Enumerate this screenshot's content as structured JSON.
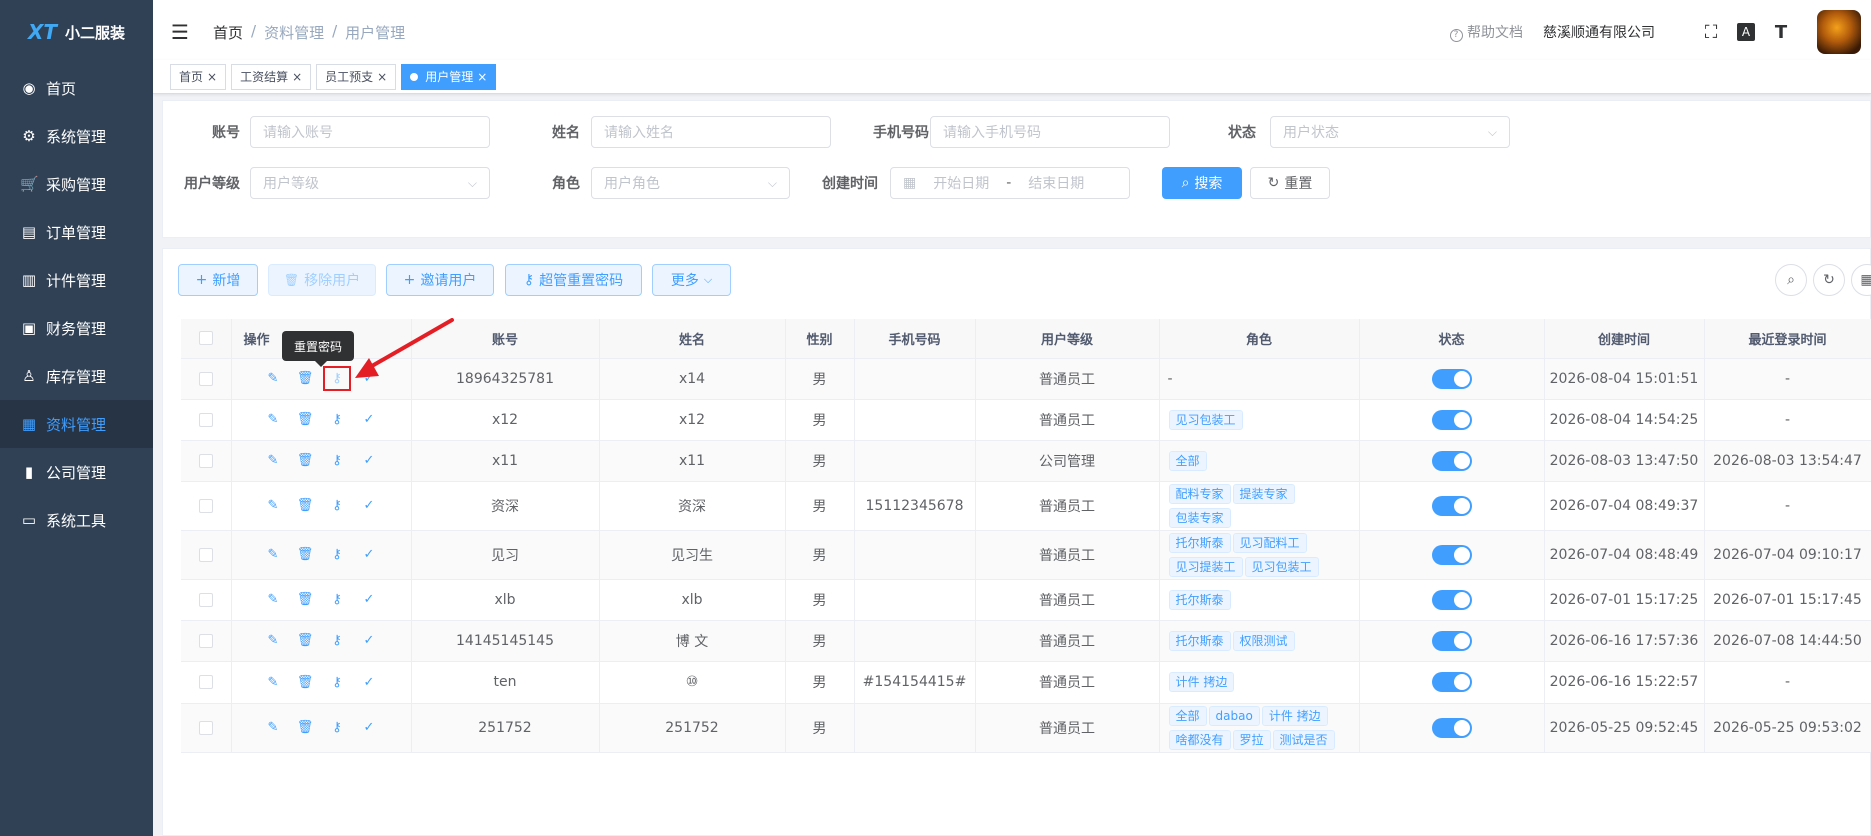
{
  "app": {
    "name": "小二服装",
    "logo_text": "XT"
  },
  "sidebar": {
    "items": [
      {
        "label": "首页",
        "icon": "dashboard-icon",
        "glyph": "◉"
      },
      {
        "label": "系统管理",
        "icon": "gear-icon",
        "glyph": "⚙"
      },
      {
        "label": "采购管理",
        "icon": "cart-icon",
        "glyph": "🛒"
      },
      {
        "label": "订单管理",
        "icon": "order-icon",
        "glyph": "▤"
      },
      {
        "label": "计件管理",
        "icon": "book-icon",
        "glyph": "▥"
      },
      {
        "label": "财务管理",
        "icon": "monitor-icon",
        "glyph": "▣"
      },
      {
        "label": "库存管理",
        "icon": "user-icon",
        "glyph": "♙"
      },
      {
        "label": "资料管理",
        "icon": "document-icon",
        "glyph": "▦"
      },
      {
        "label": "公司管理",
        "icon": "chart-icon",
        "glyph": "▮"
      },
      {
        "label": "系统工具",
        "icon": "toolbox-icon",
        "glyph": "▭"
      }
    ],
    "active_index": 7
  },
  "navbar": {
    "breadcrumb": [
      "首页",
      "资料管理",
      "用户管理"
    ],
    "separator": "/",
    "help": "帮助文档",
    "help_icon": "?",
    "company": "慈溪顺通有限公司",
    "fullscreen_icon": "⛶",
    "translate_icon": "A",
    "font_size_icon": "T"
  },
  "tags": [
    {
      "label": "首页",
      "active": false
    },
    {
      "label": "工资结算",
      "active": false
    },
    {
      "label": "员工预支",
      "active": false
    },
    {
      "label": "用户管理",
      "active": true
    }
  ],
  "tag_close": "×",
  "filters": {
    "account_label": "账号",
    "account_placeholder": "请输入账号",
    "name_label": "姓名",
    "name_placeholder": "请输入姓名",
    "phone_label": "手机号码",
    "phone_placeholder": "请输入手机号码",
    "status_label": "状态",
    "status_placeholder": "用户状态",
    "level_label": "用户等级",
    "level_placeholder": "用户等级",
    "role_label": "角色",
    "role_placeholder": "用户角色",
    "created_label": "创建时间",
    "start_placeholder": "开始日期",
    "date_sep": "-",
    "end_placeholder": "结束日期",
    "search_button": "搜索",
    "reset_button": "重置",
    "dropdown_glyph": "⌵",
    "calendar_glyph": "▦",
    "search_glyph": "⌕",
    "reset_glyph": "↻"
  },
  "toolbar": {
    "add": "新增",
    "remove": "移除用户",
    "invite": "邀请用户",
    "reset_pwd": "超管重置密码",
    "more": "更多",
    "plus_glyph": "+",
    "trash_glyph": "🗑",
    "key_glyph": "⚷",
    "chevron_glyph": "⌵",
    "search_glyph": "⌕",
    "refresh_glyph": "↻",
    "grid_glyph": "▦"
  },
  "table": {
    "headers": [
      "操作",
      "账号",
      "姓名",
      "性别",
      "手机号码",
      "用户等级",
      "角色",
      "状态",
      "创建时间",
      "最近登录时间"
    ],
    "op_glyphs": {
      "edit": "✎",
      "delete": "🗑",
      "key": "⚷",
      "check": "✓"
    },
    "rows": [
      {
        "account": "18964325781",
        "name": "x14",
        "gender": "男",
        "phone": "",
        "level": "普通员工",
        "roles": [],
        "roles_text": "-",
        "created": "2026-08-04 15:01:51",
        "last_login": "-"
      },
      {
        "account": "x12",
        "name": "x12",
        "gender": "男",
        "phone": "",
        "level": "普通员工",
        "roles": [
          "见习包装工"
        ],
        "roles_text": "",
        "created": "2026-08-04 14:54:25",
        "last_login": "-"
      },
      {
        "account": "x11",
        "name": "x11",
        "gender": "男",
        "phone": "",
        "level": "公司管理",
        "roles": [
          "全部"
        ],
        "roles_text": "",
        "created": "2026-08-03 13:47:50",
        "last_login": "2026-08-03 13:54:47"
      },
      {
        "account": "资深",
        "name": "资深",
        "gender": "男",
        "phone": "15112345678",
        "level": "普通员工",
        "roles": [
          "配料专家",
          "提装专家",
          "包装专家"
        ],
        "roles_text": "",
        "created": "2026-07-04 08:49:37",
        "last_login": "-"
      },
      {
        "account": "见习",
        "name": "见习生",
        "gender": "男",
        "phone": "",
        "level": "普通员工",
        "roles": [
          "托尔斯泰",
          "见习配料工",
          "见习提装工",
          "见习包装工"
        ],
        "roles_text": "",
        "created": "2026-07-04 08:48:49",
        "last_login": "2026-07-04 09:10:17"
      },
      {
        "account": "xlb",
        "name": "xlb",
        "gender": "男",
        "phone": "",
        "level": "普通员工",
        "roles": [
          "托尔斯泰"
        ],
        "roles_text": "",
        "created": "2026-07-01 15:17:25",
        "last_login": "2026-07-01 15:17:45"
      },
      {
        "account": "14145145145",
        "name": "博 文",
        "gender": "男",
        "phone": "",
        "level": "普通员工",
        "roles": [
          "托尔斯泰",
          "权限测试"
        ],
        "roles_text": "",
        "created": "2026-06-16 17:57:36",
        "last_login": "2026-07-08 14:44:50"
      },
      {
        "account": "ten",
        "name": "⑩",
        "gender": "男",
        "phone": "#154154415#",
        "level": "普通员工",
        "roles": [
          "计件 拷边"
        ],
        "roles_text": "",
        "created": "2026-06-16 15:22:57",
        "last_login": "-"
      },
      {
        "account": "251752",
        "name": "251752",
        "gender": "男",
        "phone": "",
        "level": "普通员工",
        "roles": [
          "全部",
          "dabao",
          "计件 拷边",
          "啥都没有",
          "罗拉",
          "测试是否"
        ],
        "roles_text": "",
        "created": "2026-05-25 09:52:45",
        "last_login": "2026-05-25 09:53:02"
      }
    ]
  },
  "tooltip": {
    "text": "重置密码"
  },
  "colors": {
    "primary": "#409eff",
    "sidebar": "#304156",
    "annotation": "#e41e25"
  }
}
